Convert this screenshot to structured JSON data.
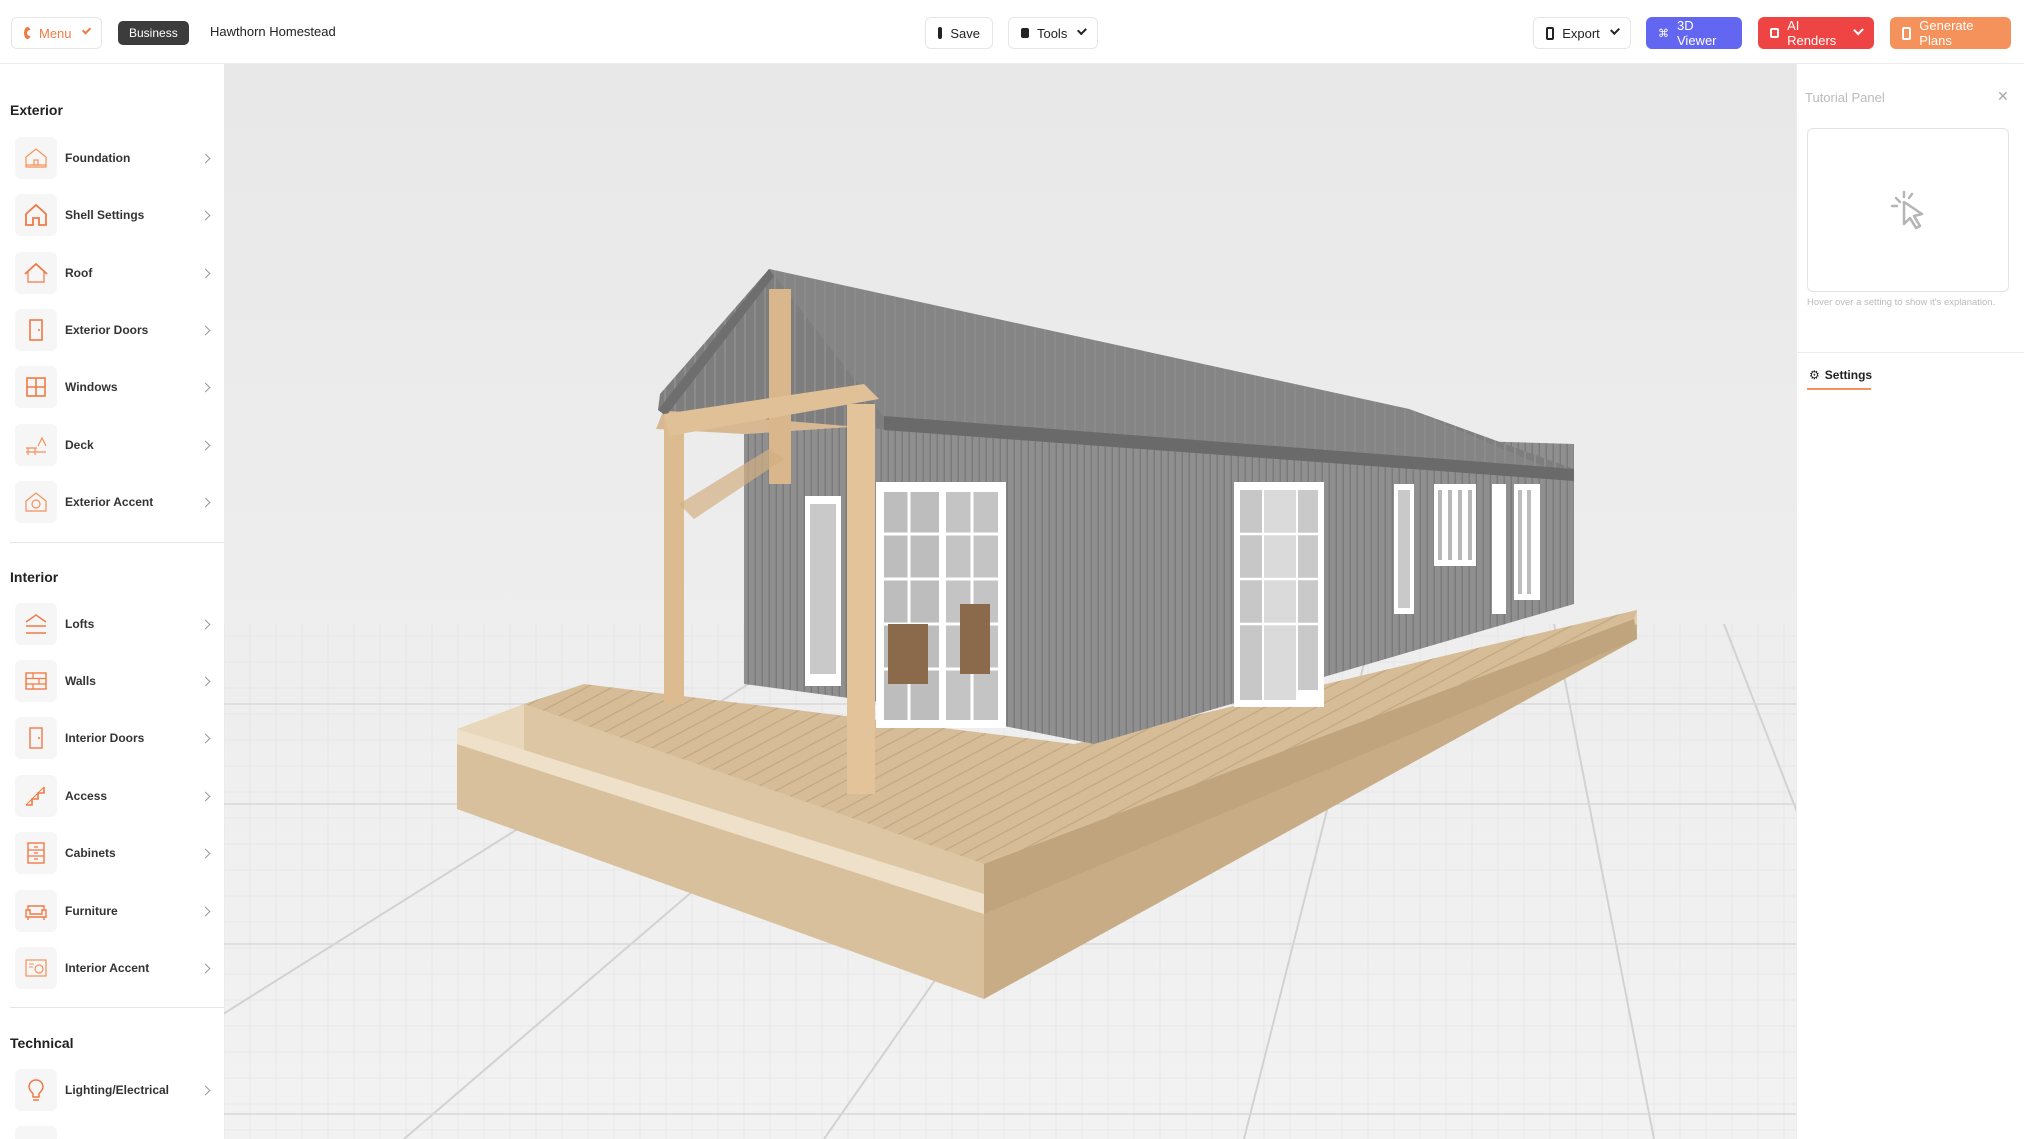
{
  "topbar": {
    "menu_label": "Menu",
    "plan_badge": "Business",
    "project_name": "Hawthorn Homestead",
    "save_label": "Save",
    "tools_label": "Tools",
    "export_label": "Export",
    "viewer_label": "3D Viewer",
    "renders_label": "AI Renders",
    "plans_label": "Generate Plans"
  },
  "sidebar": {
    "exterior_title": "Exterior",
    "exterior_items": [
      {
        "label": "Foundation",
        "icon": "foundation-icon"
      },
      {
        "label": "Shell Settings",
        "icon": "house-icon"
      },
      {
        "label": "Roof",
        "icon": "roof-icon"
      },
      {
        "label": "Exterior Doors",
        "icon": "door-icon"
      },
      {
        "label": "Windows",
        "icon": "window-icon"
      },
      {
        "label": "Deck",
        "icon": "deck-icon"
      },
      {
        "label": "Exterior Accent",
        "icon": "accent-icon"
      }
    ],
    "interior_title": "Interior",
    "interior_items": [
      {
        "label": "Lofts",
        "icon": "loft-icon"
      },
      {
        "label": "Walls",
        "icon": "wall-icon"
      },
      {
        "label": "Interior Doors",
        "icon": "door-icon"
      },
      {
        "label": "Access",
        "icon": "stairs-icon"
      },
      {
        "label": "Cabinets",
        "icon": "cabinet-icon"
      },
      {
        "label": "Furniture",
        "icon": "sofa-icon"
      },
      {
        "label": "Interior Accent",
        "icon": "accent-icon"
      }
    ],
    "technical_title": "Technical",
    "technical_items": [
      {
        "label": "Lighting/Electrical",
        "icon": "bulb-icon"
      }
    ]
  },
  "tutorial_panel": {
    "title": "Tutorial Panel",
    "hint": "Hover over a setting to show it's explanation.",
    "settings_tab": "Settings"
  },
  "colors": {
    "accent_orange": "#f07a45",
    "viewer_purple": "#6366f1",
    "renders_red": "#ef4444",
    "plans_orange": "#f5915a"
  }
}
